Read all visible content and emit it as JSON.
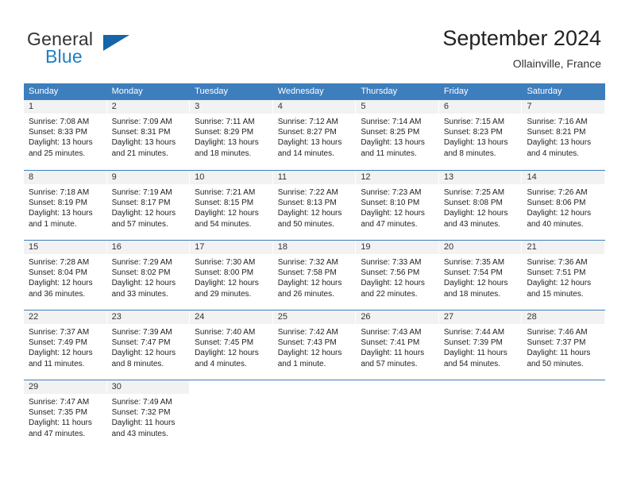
{
  "brand": {
    "word_one": "General",
    "word_two": "Blue",
    "mark": "triangle-logo"
  },
  "header": {
    "title": "September 2024",
    "subtitle": "Ollainville, France"
  },
  "colors": {
    "header_blue": "#3d7ebd",
    "brand_blue": "#1f7fc4",
    "daynum_band": "#f2f2f2",
    "text": "#222222"
  },
  "weekdays": [
    "Sunday",
    "Monday",
    "Tuesday",
    "Wednesday",
    "Thursday",
    "Friday",
    "Saturday"
  ],
  "weeks": [
    [
      {
        "day": "1",
        "sunrise": "Sunrise: 7:08 AM",
        "sunset": "Sunset: 8:33 PM",
        "daylight1": "Daylight: 13 hours",
        "daylight2": "and 25 minutes."
      },
      {
        "day": "2",
        "sunrise": "Sunrise: 7:09 AM",
        "sunset": "Sunset: 8:31 PM",
        "daylight1": "Daylight: 13 hours",
        "daylight2": "and 21 minutes."
      },
      {
        "day": "3",
        "sunrise": "Sunrise: 7:11 AM",
        "sunset": "Sunset: 8:29 PM",
        "daylight1": "Daylight: 13 hours",
        "daylight2": "and 18 minutes."
      },
      {
        "day": "4",
        "sunrise": "Sunrise: 7:12 AM",
        "sunset": "Sunset: 8:27 PM",
        "daylight1": "Daylight: 13 hours",
        "daylight2": "and 14 minutes."
      },
      {
        "day": "5",
        "sunrise": "Sunrise: 7:14 AM",
        "sunset": "Sunset: 8:25 PM",
        "daylight1": "Daylight: 13 hours",
        "daylight2": "and 11 minutes."
      },
      {
        "day": "6",
        "sunrise": "Sunrise: 7:15 AM",
        "sunset": "Sunset: 8:23 PM",
        "daylight1": "Daylight: 13 hours",
        "daylight2": "and 8 minutes."
      },
      {
        "day": "7",
        "sunrise": "Sunrise: 7:16 AM",
        "sunset": "Sunset: 8:21 PM",
        "daylight1": "Daylight: 13 hours",
        "daylight2": "and 4 minutes."
      }
    ],
    [
      {
        "day": "8",
        "sunrise": "Sunrise: 7:18 AM",
        "sunset": "Sunset: 8:19 PM",
        "daylight1": "Daylight: 13 hours",
        "daylight2": "and 1 minute."
      },
      {
        "day": "9",
        "sunrise": "Sunrise: 7:19 AM",
        "sunset": "Sunset: 8:17 PM",
        "daylight1": "Daylight: 12 hours",
        "daylight2": "and 57 minutes."
      },
      {
        "day": "10",
        "sunrise": "Sunrise: 7:21 AM",
        "sunset": "Sunset: 8:15 PM",
        "daylight1": "Daylight: 12 hours",
        "daylight2": "and 54 minutes."
      },
      {
        "day": "11",
        "sunrise": "Sunrise: 7:22 AM",
        "sunset": "Sunset: 8:13 PM",
        "daylight1": "Daylight: 12 hours",
        "daylight2": "and 50 minutes."
      },
      {
        "day": "12",
        "sunrise": "Sunrise: 7:23 AM",
        "sunset": "Sunset: 8:10 PM",
        "daylight1": "Daylight: 12 hours",
        "daylight2": "and 47 minutes."
      },
      {
        "day": "13",
        "sunrise": "Sunrise: 7:25 AM",
        "sunset": "Sunset: 8:08 PM",
        "daylight1": "Daylight: 12 hours",
        "daylight2": "and 43 minutes."
      },
      {
        "day": "14",
        "sunrise": "Sunrise: 7:26 AM",
        "sunset": "Sunset: 8:06 PM",
        "daylight1": "Daylight: 12 hours",
        "daylight2": "and 40 minutes."
      }
    ],
    [
      {
        "day": "15",
        "sunrise": "Sunrise: 7:28 AM",
        "sunset": "Sunset: 8:04 PM",
        "daylight1": "Daylight: 12 hours",
        "daylight2": "and 36 minutes."
      },
      {
        "day": "16",
        "sunrise": "Sunrise: 7:29 AM",
        "sunset": "Sunset: 8:02 PM",
        "daylight1": "Daylight: 12 hours",
        "daylight2": "and 33 minutes."
      },
      {
        "day": "17",
        "sunrise": "Sunrise: 7:30 AM",
        "sunset": "Sunset: 8:00 PM",
        "daylight1": "Daylight: 12 hours",
        "daylight2": "and 29 minutes."
      },
      {
        "day": "18",
        "sunrise": "Sunrise: 7:32 AM",
        "sunset": "Sunset: 7:58 PM",
        "daylight1": "Daylight: 12 hours",
        "daylight2": "and 26 minutes."
      },
      {
        "day": "19",
        "sunrise": "Sunrise: 7:33 AM",
        "sunset": "Sunset: 7:56 PM",
        "daylight1": "Daylight: 12 hours",
        "daylight2": "and 22 minutes."
      },
      {
        "day": "20",
        "sunrise": "Sunrise: 7:35 AM",
        "sunset": "Sunset: 7:54 PM",
        "daylight1": "Daylight: 12 hours",
        "daylight2": "and 18 minutes."
      },
      {
        "day": "21",
        "sunrise": "Sunrise: 7:36 AM",
        "sunset": "Sunset: 7:51 PM",
        "daylight1": "Daylight: 12 hours",
        "daylight2": "and 15 minutes."
      }
    ],
    [
      {
        "day": "22",
        "sunrise": "Sunrise: 7:37 AM",
        "sunset": "Sunset: 7:49 PM",
        "daylight1": "Daylight: 12 hours",
        "daylight2": "and 11 minutes."
      },
      {
        "day": "23",
        "sunrise": "Sunrise: 7:39 AM",
        "sunset": "Sunset: 7:47 PM",
        "daylight1": "Daylight: 12 hours",
        "daylight2": "and 8 minutes."
      },
      {
        "day": "24",
        "sunrise": "Sunrise: 7:40 AM",
        "sunset": "Sunset: 7:45 PM",
        "daylight1": "Daylight: 12 hours",
        "daylight2": "and 4 minutes."
      },
      {
        "day": "25",
        "sunrise": "Sunrise: 7:42 AM",
        "sunset": "Sunset: 7:43 PM",
        "daylight1": "Daylight: 12 hours",
        "daylight2": "and 1 minute."
      },
      {
        "day": "26",
        "sunrise": "Sunrise: 7:43 AM",
        "sunset": "Sunset: 7:41 PM",
        "daylight1": "Daylight: 11 hours",
        "daylight2": "and 57 minutes."
      },
      {
        "day": "27",
        "sunrise": "Sunrise: 7:44 AM",
        "sunset": "Sunset: 7:39 PM",
        "daylight1": "Daylight: 11 hours",
        "daylight2": "and 54 minutes."
      },
      {
        "day": "28",
        "sunrise": "Sunrise: 7:46 AM",
        "sunset": "Sunset: 7:37 PM",
        "daylight1": "Daylight: 11 hours",
        "daylight2": "and 50 minutes."
      }
    ],
    [
      {
        "day": "29",
        "sunrise": "Sunrise: 7:47 AM",
        "sunset": "Sunset: 7:35 PM",
        "daylight1": "Daylight: 11 hours",
        "daylight2": "and 47 minutes."
      },
      {
        "day": "30",
        "sunrise": "Sunrise: 7:49 AM",
        "sunset": "Sunset: 7:32 PM",
        "daylight1": "Daylight: 11 hours",
        "daylight2": "and 43 minutes."
      },
      {
        "day": "",
        "sunrise": "",
        "sunset": "",
        "daylight1": "",
        "daylight2": ""
      },
      {
        "day": "",
        "sunrise": "",
        "sunset": "",
        "daylight1": "",
        "daylight2": ""
      },
      {
        "day": "",
        "sunrise": "",
        "sunset": "",
        "daylight1": "",
        "daylight2": ""
      },
      {
        "day": "",
        "sunrise": "",
        "sunset": "",
        "daylight1": "",
        "daylight2": ""
      },
      {
        "day": "",
        "sunrise": "",
        "sunset": "",
        "daylight1": "",
        "daylight2": ""
      }
    ]
  ]
}
